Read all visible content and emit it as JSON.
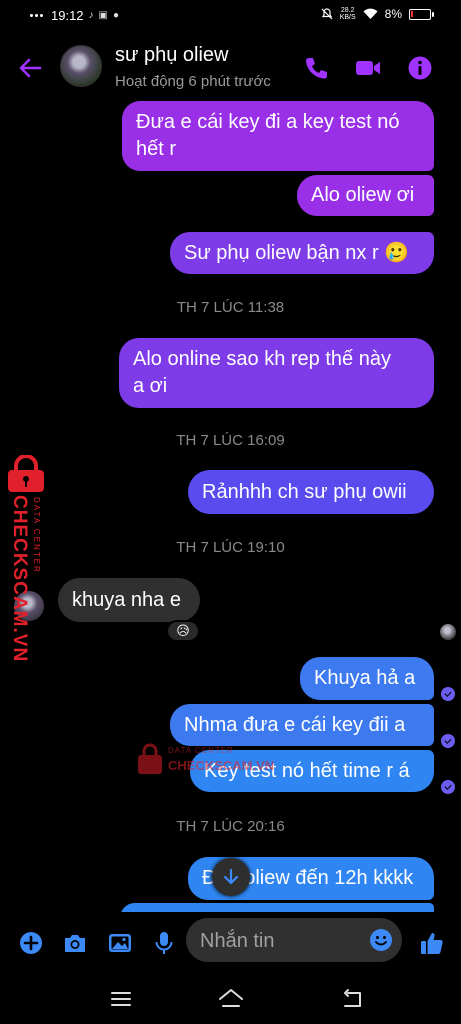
{
  "status_bar": {
    "time": "19:12",
    "network_speed_value": "28.2",
    "network_speed_unit": "KB/S",
    "battery": "8%"
  },
  "header": {
    "contact_name": "sư phụ oliew",
    "contact_status": "Hoạt động 6 phút trước",
    "icons": [
      "back-arrow-icon",
      "phone-icon",
      "video-camera-icon",
      "info-icon"
    ],
    "accent_color": "#a033ff"
  },
  "messages": [
    {
      "kind": "bubble",
      "direction": "outgoing",
      "text": "Đưa e cái key đi a key test nó\nhết r"
    },
    {
      "kind": "bubble",
      "direction": "outgoing",
      "text": "Alo oliew ơi"
    },
    {
      "kind": "bubble",
      "direction": "outgoing",
      "text": "Sư phụ oliew bận nx r 🥲"
    },
    {
      "kind": "timestamp",
      "text": "TH 7 LÚC 11:38"
    },
    {
      "kind": "bubble",
      "direction": "outgoing",
      "text": "Alo online sao kh rep thế này\na ơi"
    },
    {
      "kind": "timestamp",
      "text": "TH 7 LÚC 16:09"
    },
    {
      "kind": "bubble",
      "direction": "outgoing",
      "text": "Rảnhhh ch sư phụ owii"
    },
    {
      "kind": "timestamp",
      "text": "TH 7 LÚC 19:10"
    },
    {
      "kind": "bubble",
      "direction": "incoming",
      "text": "khuya nha e",
      "reaction": "😥"
    },
    {
      "kind": "bubble",
      "direction": "outgoing",
      "text": "Khuya hả a"
    },
    {
      "kind": "bubble",
      "direction": "outgoing",
      "text": "Nhma đưa e cái key đii a"
    },
    {
      "kind": "bubble",
      "direction": "outgoing",
      "text": "Key test nó hết time r á"
    },
    {
      "kind": "timestamp",
      "text": "TH 7 LÚC 20:16"
    },
    {
      "kind": "bubble",
      "direction": "outgoing",
      "text": "Đ     oliew đến 12h kkkk"
    }
  ],
  "composer": {
    "placeholder": "Nhắn tin",
    "icons": [
      "plus-icon",
      "camera-icon",
      "image-icon",
      "microphone-icon",
      "emoji-icon",
      "thumbs-up-icon"
    ]
  },
  "watermark": {
    "brand": "CHECKSCAM.VN",
    "tagline": "DATA CENTER",
    "color": "#e0202a"
  },
  "nav_bar": {
    "icons": [
      "menu-icon",
      "home-icon",
      "back-icon"
    ]
  },
  "colors": {
    "background": "#000000",
    "bubble_top": "#9a2fe8",
    "bubble_bottom": "#2f86f2",
    "incoming_bubble": "#303030"
  }
}
